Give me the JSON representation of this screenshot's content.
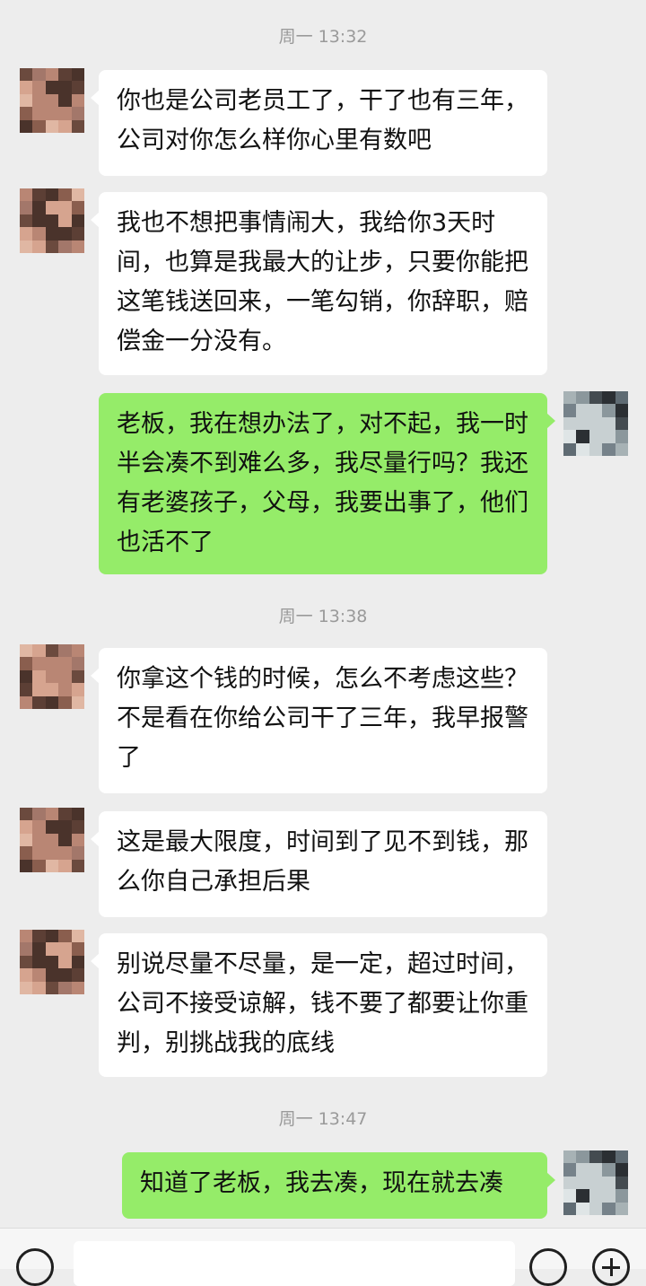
{
  "timestamps": [
    "周一 13:32",
    "周一 13:38",
    "周一 13:47"
  ],
  "messages": [
    {
      "sender": "boss",
      "text": "你也是公司老员工了，干了也有三年，公司对你怎么样你心里有数吧"
    },
    {
      "sender": "boss",
      "text": "我也不想把事情闹大，我给你3天时间，也算是我最大的让步，只要你能把这笔钱送回来，一笔勾销，你辞职，赔偿金一分没有。"
    },
    {
      "sender": "me",
      "text": "老板，我在想办法了，对不起，我一时半会凑不到难么多，我尽量行吗？我还有老婆孩子，父母，我要出事了，他们也活不了"
    },
    {
      "sender": "boss",
      "text": "你拿这个钱的时候，怎么不考虑这些？不是看在你给公司干了三年，我早报警了"
    },
    {
      "sender": "boss",
      "text": "这是最大限度，时间到了见不到钱，那么你自己承担后果"
    },
    {
      "sender": "boss",
      "text": "别说尽量不尽量，是一定，超过时间，公司不接受谅解，钱不要了都要让你重判，别挑战我的底线"
    },
    {
      "sender": "me",
      "text": "知道了老板，我去凑，现在就去凑"
    }
  ],
  "colors": {
    "background": "#ededed",
    "incoming_bubble": "#ffffff",
    "outgoing_bubble": "#95ec69",
    "timestamp_text": "#9a9a9a"
  },
  "input_bar": {
    "voice_icon": "voice-icon",
    "emoji_icon": "emoji-icon",
    "plus_icon": "plus-icon"
  }
}
